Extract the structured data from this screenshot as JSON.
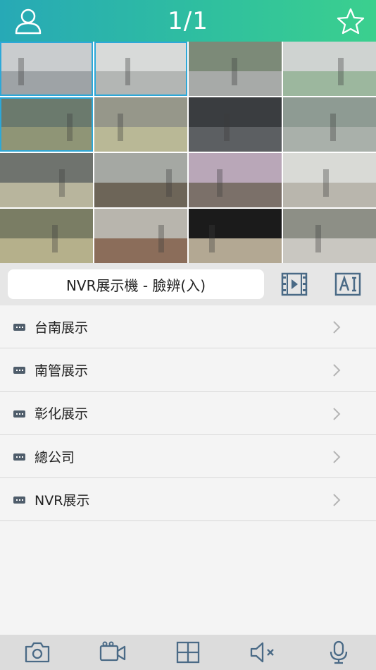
{
  "header": {
    "title": "1/1",
    "left_icon": "user-icon",
    "right_icon": "star-icon",
    "gradient": [
      "#27a9b6",
      "#3bd08e"
    ]
  },
  "cameras": [
    {
      "wall": "#c9ccce",
      "floor": "#9ea3a6",
      "selected": true
    },
    {
      "wall": "#d8dad9",
      "floor": "#b3b6b4",
      "selected": true
    },
    {
      "wall": "#7c8a78",
      "floor": "#a7aaa8",
      "selected": false
    },
    {
      "wall": "#cfd3d1",
      "floor": "#9cb79e",
      "selected": false
    },
    {
      "wall": "#6b7a6d",
      "floor": "#8f9576",
      "selected": true
    },
    {
      "wall": "#96978a",
      "floor": "#b9b896",
      "selected": false
    },
    {
      "wall": "#3a3d40",
      "floor": "#5c5f62",
      "selected": false
    },
    {
      "wall": "#8e9b93",
      "floor": "#a9b0aa",
      "selected": false
    },
    {
      "wall": "#6f736e",
      "floor": "#b8b59d",
      "selected": false
    },
    {
      "wall": "#a5a8a3",
      "floor": "#6d6558",
      "selected": false
    },
    {
      "wall": "#b9a7b8",
      "floor": "#7b7069",
      "selected": false
    },
    {
      "wall": "#d9dad6",
      "floor": "#b9b6ad",
      "selected": false
    },
    {
      "wall": "#7a7d64",
      "floor": "#b5b08b",
      "selected": false
    },
    {
      "wall": "#b8b5ad",
      "floor": "#8b6d5a",
      "selected": false
    },
    {
      "wall": "#1b1b1b",
      "floor": "#b3a893",
      "selected": false
    },
    {
      "wall": "#8d8f86",
      "floor": "#c9c7c1",
      "selected": false
    }
  ],
  "device_bar": {
    "current_device": "NVR展示機 - 臉辨(入)",
    "playback_icon": "playback-film-icon",
    "ai_icon": "ai-icon"
  },
  "devices": [
    {
      "label": "台南展示"
    },
    {
      "label": "南管展示"
    },
    {
      "label": "彰化展示"
    },
    {
      "label": "總公司"
    },
    {
      "label": "NVR展示"
    }
  ],
  "toolbar": {
    "icons": [
      "camera-icon",
      "video-record-icon",
      "grid-layout-icon",
      "speaker-mute-icon",
      "microphone-icon"
    ]
  }
}
